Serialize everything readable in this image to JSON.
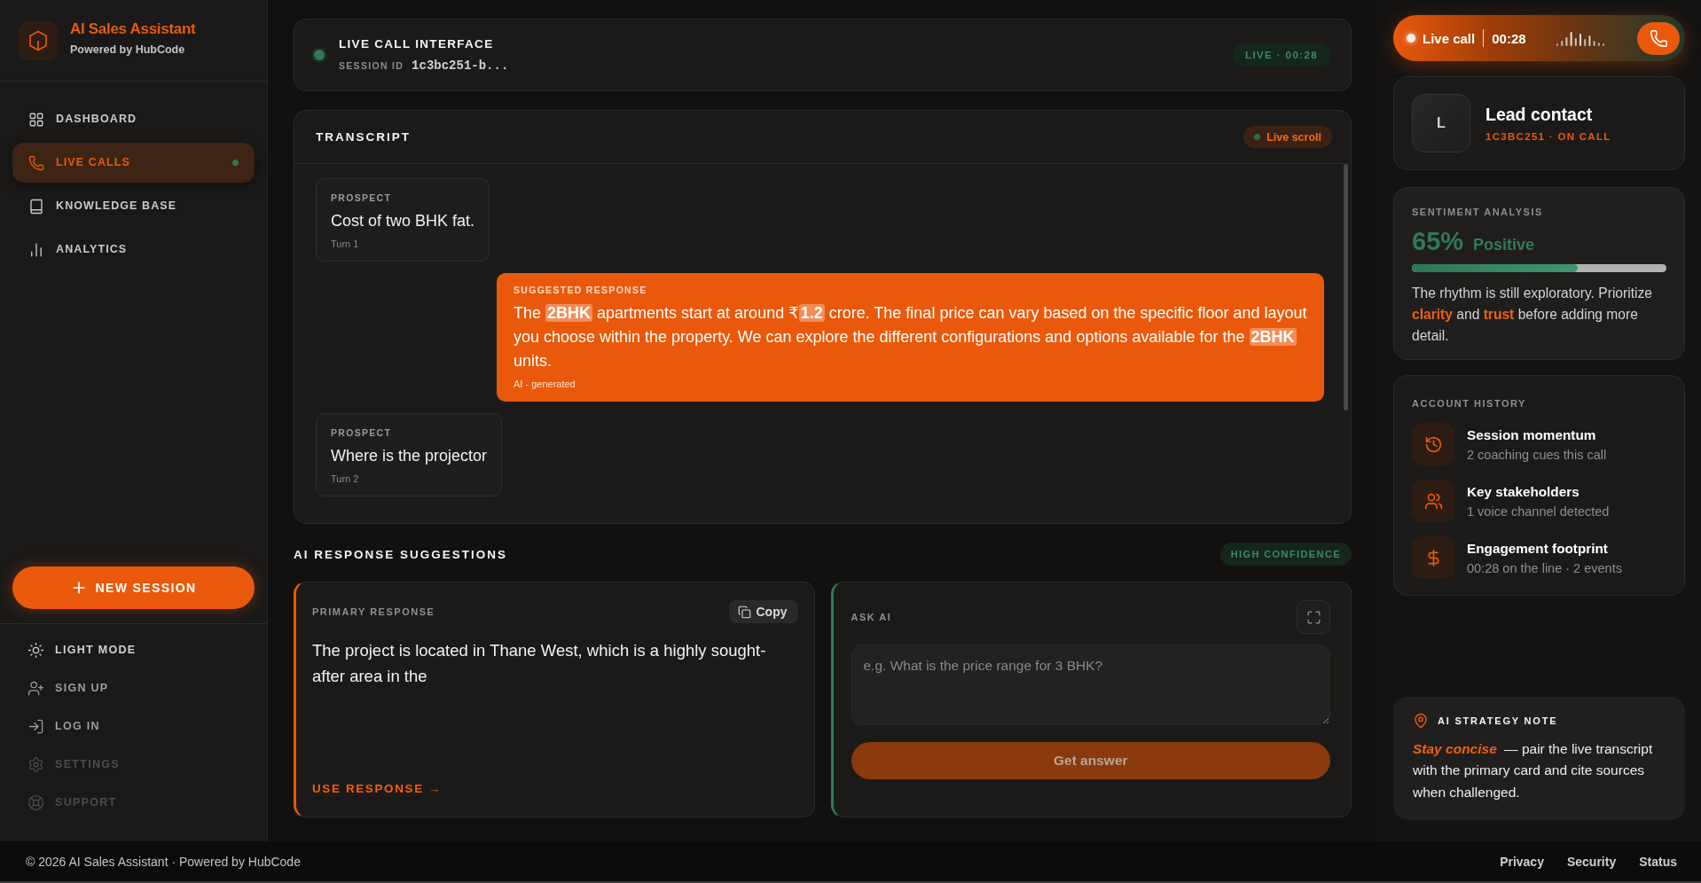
{
  "sidebar": {
    "brand": {
      "title": "AI Sales Assistant",
      "subtitle": "Powered by HubCode"
    },
    "nav": [
      {
        "label": "DASHBOARD",
        "selected": false,
        "live": false
      },
      {
        "label": "LIVE CALLS",
        "selected": true,
        "live": true
      },
      {
        "label": "KNOWLEDGE BASE",
        "selected": false,
        "live": false
      },
      {
        "label": "ANALYTICS",
        "selected": false,
        "live": false
      }
    ],
    "new_session": {
      "label": "NEW SESSION"
    },
    "theme_toggle": {
      "label": "LIGHT MODE"
    },
    "account_links": [
      {
        "label": "SIGN UP",
        "disabled": false
      },
      {
        "label": "LOG IN",
        "disabled": false
      },
      {
        "label": "SETTINGS",
        "disabled": true
      },
      {
        "label": "SUPPORT",
        "disabled": true
      }
    ]
  },
  "call_header": {
    "title": "LIVE CALL INTERFACE",
    "session_label": "SESSION ID",
    "session_id": "1c3bc251-b...",
    "status": "LIVE · 00:28"
  },
  "transcript": {
    "title": "TRANSCRIPT",
    "badge": "Live scroll",
    "messages": [
      {
        "kind": "prospect",
        "label": "PROSPECT",
        "text": "Cost of two BHK fat.",
        "meta": "Turn 1"
      },
      {
        "kind": "suggestion",
        "label": "SUGGESTED RESPONSE",
        "text": "The **2BHK** apartments start at around ₹**1.2** crore. The final price can vary based on the specific floor and layout you choose within the property. We can explore the different configurations and options available for the **2BHK** units.",
        "meta": "AI - generated"
      },
      {
        "kind": "prospect",
        "label": "PROSPECT",
        "text": "Where is the projector",
        "meta": "Turn 2"
      }
    ]
  },
  "suggestions": {
    "title": "AI RESPONSE SUGGESTIONS",
    "badge": "HIGH CONFIDENCE",
    "primary": {
      "label": "PRIMARY RESPONSE",
      "copy": "Copy",
      "text": "The project is located in Thane West, which is a highly sought-after area in the",
      "action": "USE RESPONSE →"
    },
    "ask_ai": {
      "label": "ASK AI",
      "placeholder": "e.g. What is the price range for 3 BHK?",
      "button": {
        "label": "Get answer",
        "disabled": true
      }
    }
  },
  "right_panel": {
    "call_bar": {
      "label": "Live call",
      "timer": "00:28"
    },
    "lead": {
      "initial": "L",
      "name": "Lead contact",
      "status": "1C3BC251 · ON CALL"
    },
    "sentiment": {
      "title": "SENTIMENT ANALYSIS",
      "score": "65%",
      "label": "Positive",
      "level": 0.65,
      "text": "The rhythm is still exploratory. Prioritize **clarity** and **trust** before adding more detail."
    },
    "history": {
      "title": "ACCOUNT HISTORY",
      "items": [
        {
          "title": "Session momentum",
          "detail": "2 coaching cues this call"
        },
        {
          "title": "Key stakeholders",
          "detail": "1 voice channel detected"
        },
        {
          "title": "Engagement footprint",
          "detail": "00:28 on the line · 2 events"
        }
      ]
    },
    "strategy_note": {
      "title": "AI STRATEGY NOTE",
      "text": "*Stay concise* — pair the live transcript with the primary card and cite sources when challenged."
    }
  },
  "footer": {
    "copyright": "© 2026 AI Sales Assistant · Powered by HubCode",
    "links": [
      "Privacy",
      "Security",
      "Status"
    ]
  }
}
